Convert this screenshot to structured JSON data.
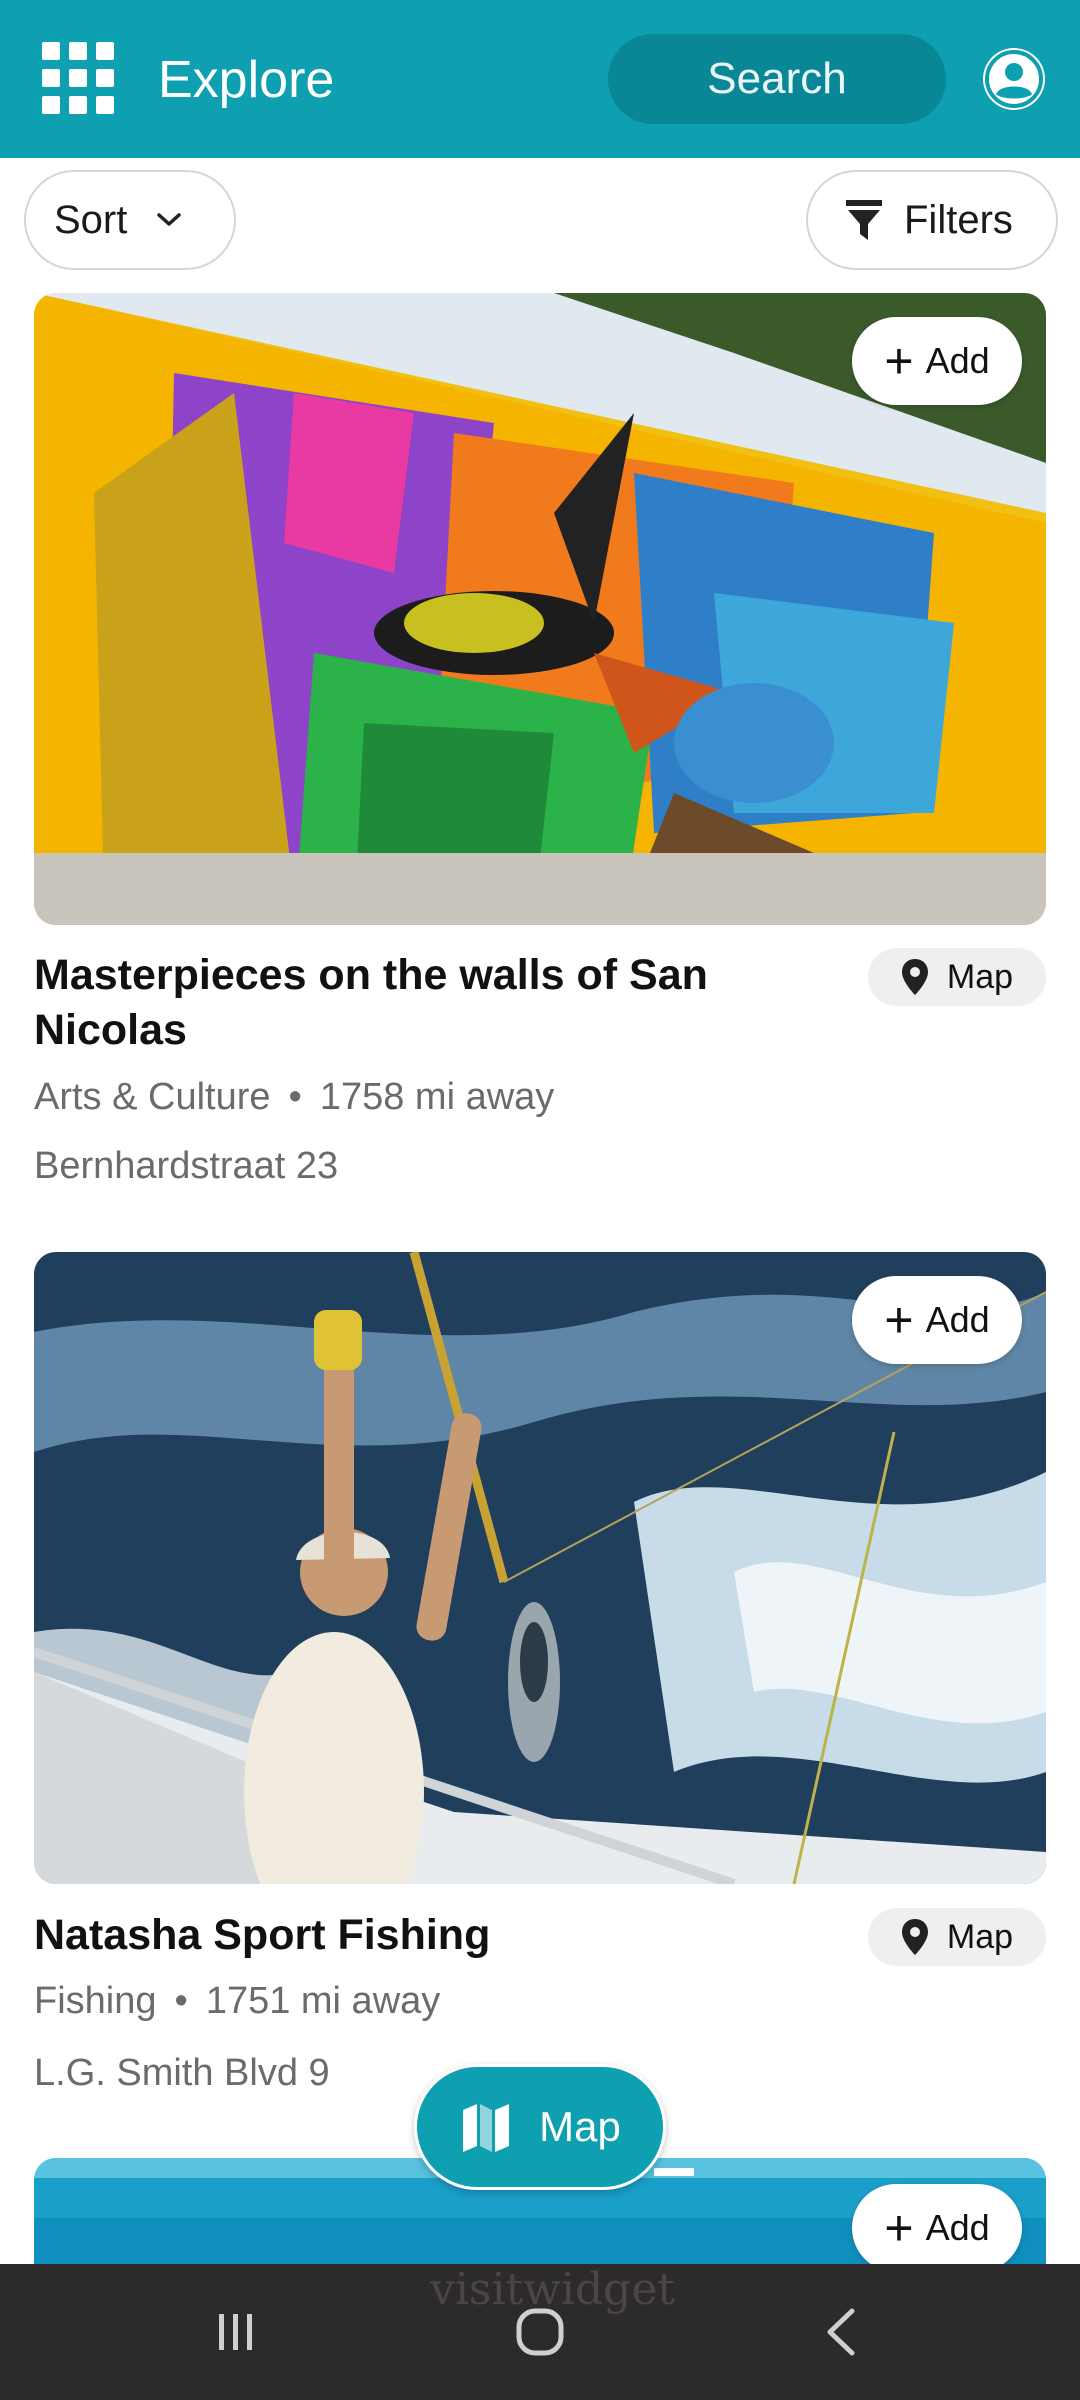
{
  "header": {
    "title": "Explore",
    "search_label": "Search"
  },
  "controls": {
    "sort_label": "Sort",
    "filters_label": "Filters"
  },
  "cards": [
    {
      "title": "Masterpieces on the walls of San Nicolas",
      "category": "Arts & Culture",
      "distance": "1758 mi away",
      "address": "Bernhardstraat 23",
      "add_label": "Add",
      "map_label": "Map"
    },
    {
      "title": "Natasha Sport Fishing",
      "category": "Fishing",
      "distance": "1751 mi away",
      "address": "L.G. Smith Blvd 9",
      "add_label": "Add",
      "map_label": "Map"
    },
    {
      "add_label": "Add"
    }
  ],
  "meta_separator": "•",
  "fab": {
    "label": "Map"
  },
  "nav_bar": {
    "ghost_text": "visitwidget",
    "buttons": [
      "recent-apps-icon",
      "home-icon",
      "back-icon"
    ]
  },
  "colors": {
    "brand": "#0e9fb0",
    "brand_dark": "#0a8796",
    "meta_text": "#6b6b6b"
  }
}
